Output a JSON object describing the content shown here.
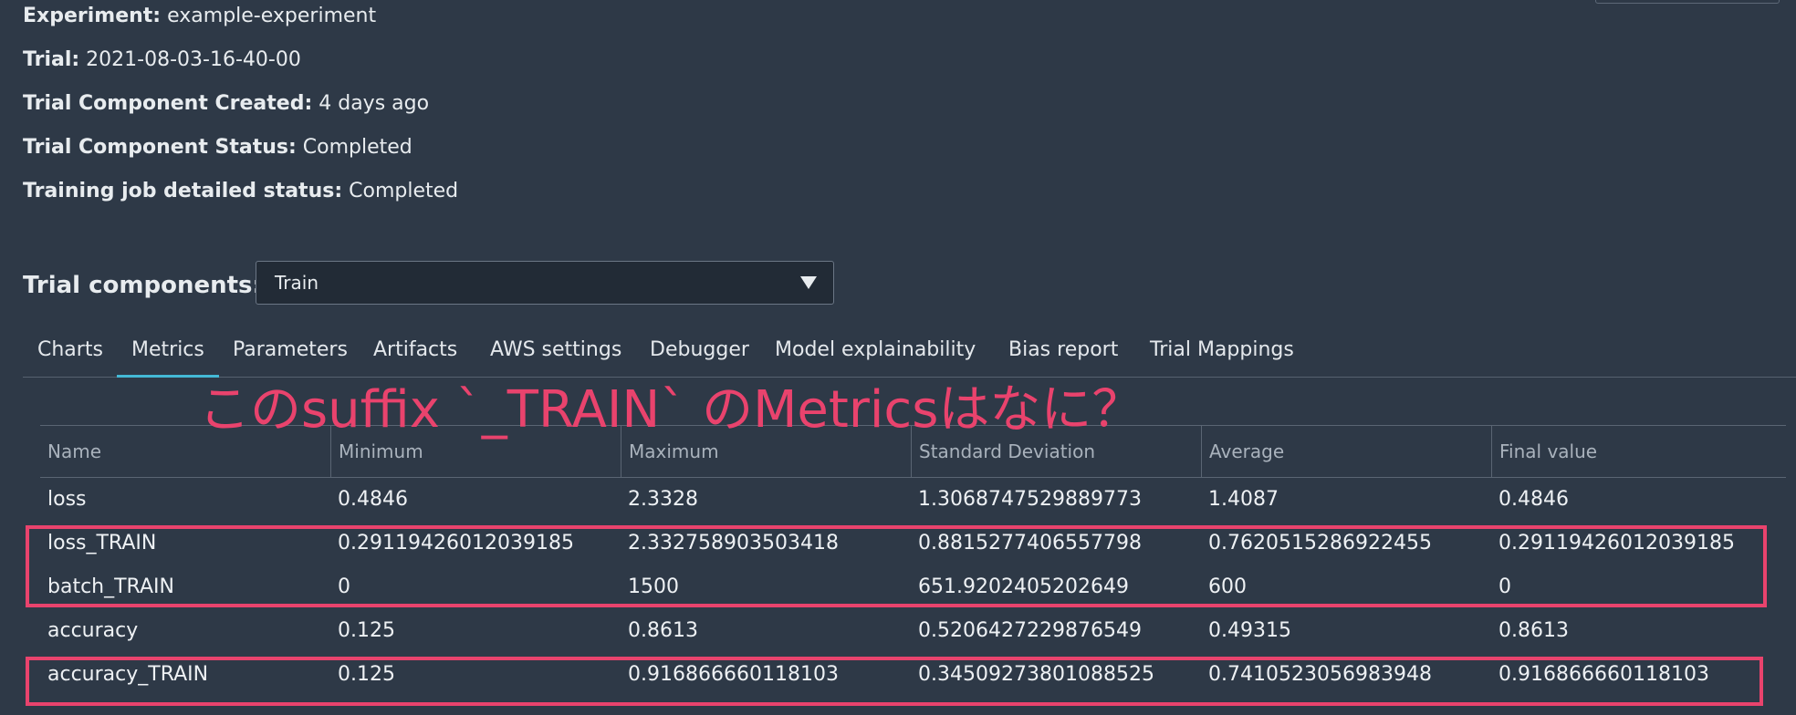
{
  "info": {
    "experiment_label": "Experiment:",
    "experiment_value": "example-experiment",
    "trial_label": "Trial:",
    "trial_value": "2021-08-03-16-40-00",
    "created_label": "Trial Component Created:",
    "created_value": "4 days ago",
    "status_label": "Trial Component Status:",
    "status_value": "Completed",
    "training_label": "Training job detailed status:",
    "training_value": "Completed"
  },
  "trial_components": {
    "label": "Trial components:",
    "selected": "Train"
  },
  "tabs": [
    {
      "label": "Charts"
    },
    {
      "label": "Metrics"
    },
    {
      "label": "Parameters"
    },
    {
      "label": "Artifacts"
    },
    {
      "label": "AWS settings"
    },
    {
      "label": "Debugger"
    },
    {
      "label": "Model explainability"
    },
    {
      "label": "Bias report"
    },
    {
      "label": "Trial Mappings"
    }
  ],
  "active_tab": "Metrics",
  "annotation": {
    "text": "このsuffix `_TRAIN` のMetricsはなに？",
    "color": "#e9436d"
  },
  "metrics_table": {
    "columns": [
      "Name",
      "Minimum",
      "Maximum",
      "Standard Deviation",
      "Average",
      "Final value"
    ],
    "rows": [
      [
        "loss",
        "0.4846",
        "2.3328",
        "1.3068747529889773",
        "1.4087",
        "0.4846"
      ],
      [
        "loss_TRAIN",
        "0.29119426012039185",
        "2.332758903503418",
        "0.8815277406557798",
        "0.7620515286922455",
        "0.29119426012039185"
      ],
      [
        "batch_TRAIN",
        "0",
        "1500",
        "651.9202405202649",
        "600",
        "0"
      ],
      [
        "accuracy",
        "0.125",
        "0.8613",
        "0.5206427229876549",
        "0.49315",
        "0.8613"
      ],
      [
        "accuracy_TRAIN",
        "0.125",
        "0.916866660118103",
        "0.34509273801088525",
        "0.7410523056983948",
        "0.916866660118103"
      ]
    ]
  },
  "colors": {
    "background": "#2e3947",
    "accent": "#44b9d6",
    "highlight": "#e9436d"
  }
}
